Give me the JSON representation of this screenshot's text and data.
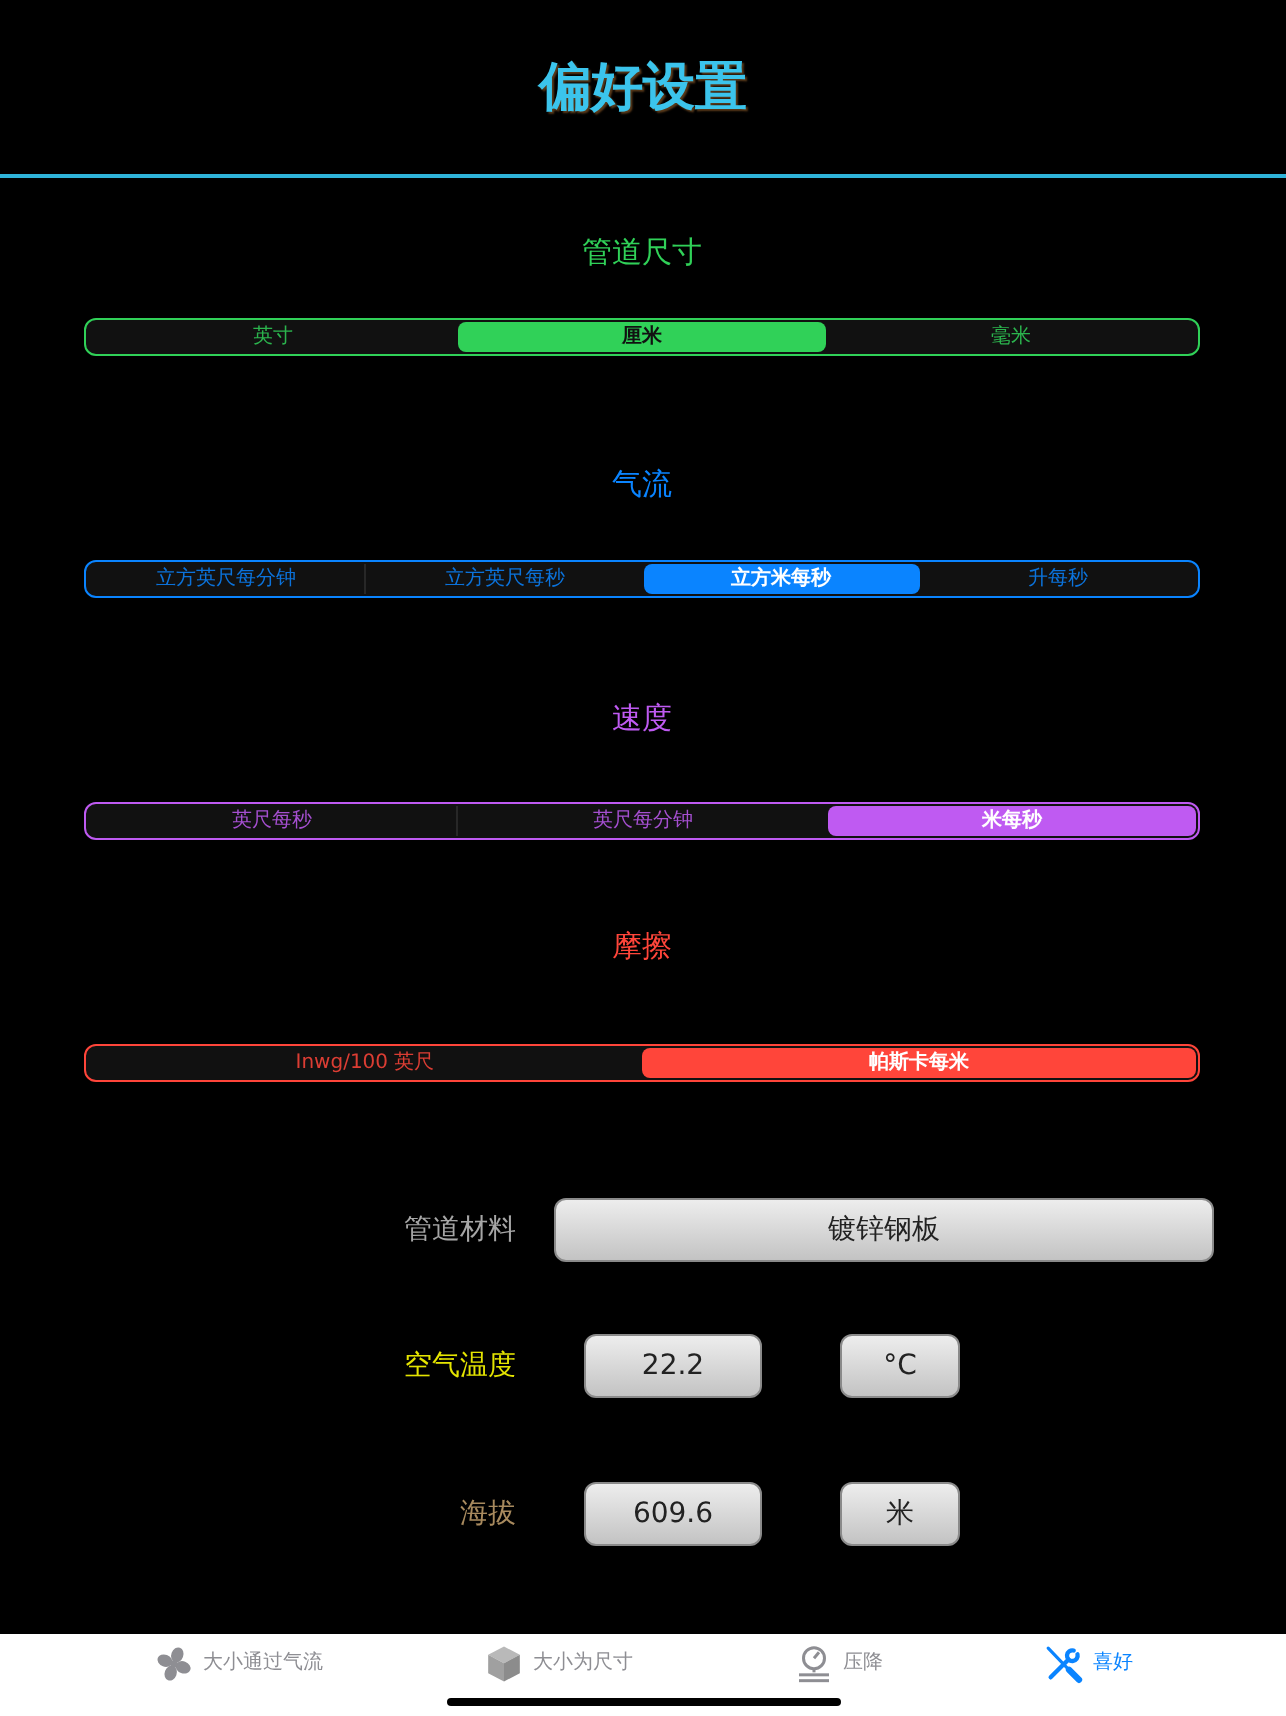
{
  "title": "偏好设置",
  "sections": [
    {
      "title": "管道尺寸",
      "color": "#30d158",
      "options": [
        {
          "label": "英寸",
          "selected": false
        },
        {
          "label": "厘米",
          "selected": true
        },
        {
          "label": "毫米",
          "selected": false
        }
      ]
    },
    {
      "title": "气流",
      "color": "#0a84ff",
      "options": [
        {
          "label": "立方英尺每分钟",
          "selected": false
        },
        {
          "label": "立方英尺每秒",
          "selected": false
        },
        {
          "label": "立方米每秒",
          "selected": true
        },
        {
          "label": "升每秒",
          "selected": false
        }
      ]
    },
    {
      "title": "速度",
      "color": "#bf5af2",
      "options": [
        {
          "label": "英尺每秒",
          "selected": false
        },
        {
          "label": "英尺每分钟",
          "selected": false
        },
        {
          "label": "米每秒",
          "selected": true
        }
      ]
    },
    {
      "title": "摩擦",
      "color": "#ff453a",
      "options": [
        {
          "label": "Inwg/100 英尺",
          "selected": false
        },
        {
          "label": "帕斯卡每米",
          "selected": true
        }
      ]
    }
  ],
  "settings": [
    {
      "kind": "picker",
      "label": "管道材料",
      "color": "#a6a6a6",
      "value": "镀锌钢板"
    },
    {
      "kind": "value_unit",
      "label": "空气温度",
      "color": "#e5e500",
      "value": "22.2",
      "unit": "°C"
    },
    {
      "kind": "value_unit",
      "label": "海拔",
      "color": "#a88a5e",
      "value": "609.6",
      "unit": "米"
    }
  ],
  "tab_bar": [
    {
      "label": "大小通过气流",
      "selected": false
    },
    {
      "label": "大小为尺寸",
      "selected": false
    },
    {
      "label": "压降",
      "selected": false
    },
    {
      "label": "喜好",
      "selected": true
    }
  ]
}
